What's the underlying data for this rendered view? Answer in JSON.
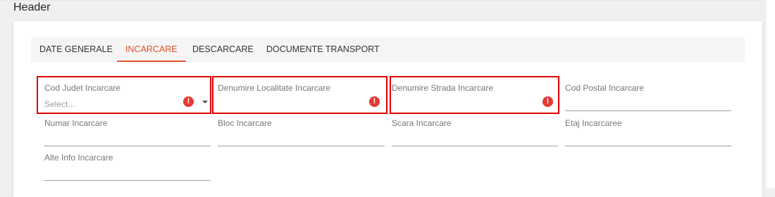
{
  "header": {
    "title": "Header"
  },
  "tabs": [
    {
      "label": "DATE GENERALE"
    },
    {
      "label": "INCARCARE"
    },
    {
      "label": "DESCARCARE"
    },
    {
      "label": "DOCUMENTE TRANSPORT"
    }
  ],
  "active_tab": "INCARCARE",
  "colors": {
    "accent": "#e65129",
    "error": "#e53935",
    "error_outline": "#e00000"
  },
  "fields": {
    "cod_judet": {
      "label": "Cod Judet Incarcare",
      "placeholder": "Select...",
      "error": true
    },
    "denumire_localitate": {
      "label": "Denumire Localitate Incarcare",
      "value": "",
      "error": true
    },
    "denumire_strada": {
      "label": "Denumire Strada Incarcare",
      "value": "",
      "error": true
    },
    "cod_postal": {
      "label": "Cod Postal Incarcare",
      "value": ""
    },
    "numar": {
      "label": "Numar Incarcare",
      "value": ""
    },
    "bloc": {
      "label": "Bloc Incarcare",
      "value": ""
    },
    "scara": {
      "label": "Scara Incarcare",
      "value": ""
    },
    "etaj": {
      "label": "Etaj Incarcaree",
      "value": ""
    },
    "alte_info": {
      "label": "Alte Info Incarcare",
      "value": ""
    }
  },
  "icons": {
    "error": "error-icon",
    "dropdown": "chevron-down-icon"
  }
}
